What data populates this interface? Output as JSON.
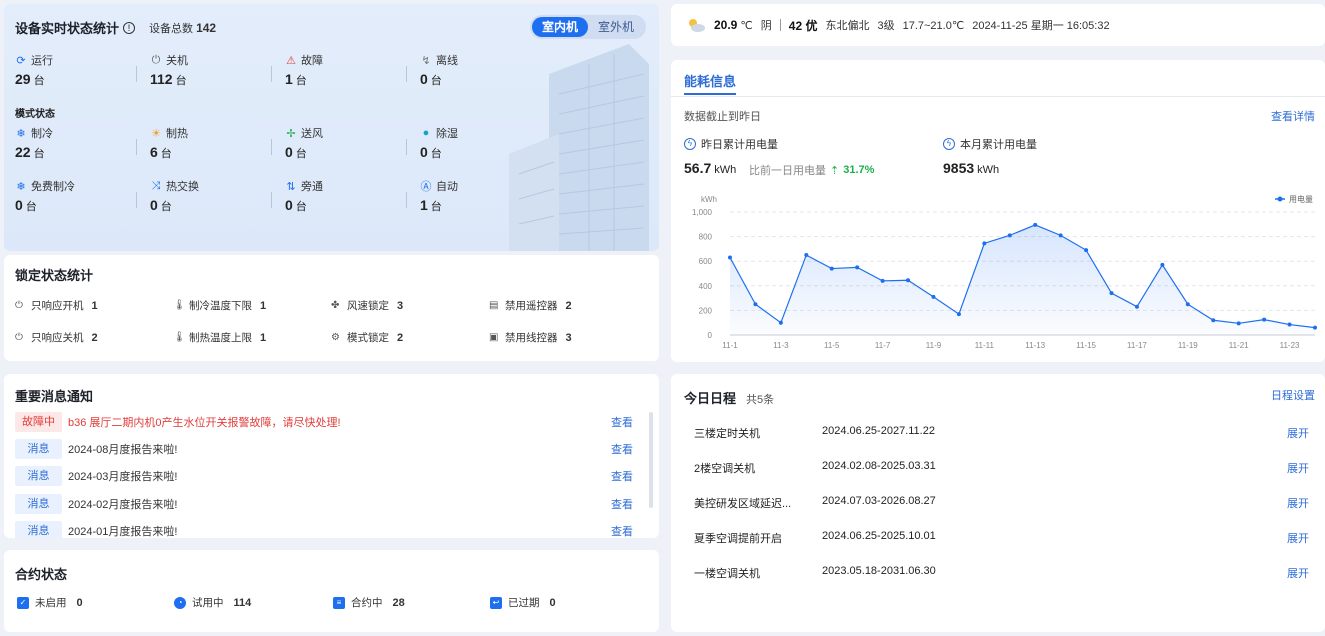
{
  "device": {
    "title": "设备实时状态统计",
    "total_label": "设备总数",
    "total": "142",
    "tabs": [
      "室内机",
      "室外机"
    ],
    "stats": [
      {
        "label": "运行",
        "value": "29",
        "unit": "台"
      },
      {
        "label": "关机",
        "value": "112",
        "unit": "台"
      },
      {
        "label": "故障",
        "value": "1",
        "unit": "台"
      },
      {
        "label": "离线",
        "value": "0",
        "unit": "台"
      }
    ],
    "mode_title": "模式状态",
    "modes": [
      {
        "label": "制冷",
        "value": "22",
        "unit": "台"
      },
      {
        "label": "制热",
        "value": "6",
        "unit": "台"
      },
      {
        "label": "送风",
        "value": "0",
        "unit": "台"
      },
      {
        "label": "除湿",
        "value": "0",
        "unit": "台"
      },
      {
        "label": "免费制冷",
        "value": "0",
        "unit": "台"
      },
      {
        "label": "热交换",
        "value": "0",
        "unit": "台"
      },
      {
        "label": "旁通",
        "value": "0",
        "unit": "台"
      },
      {
        "label": "自动",
        "value": "1",
        "unit": "台"
      }
    ]
  },
  "lock": {
    "title": "锁定状态统计",
    "items": [
      {
        "label": "只响应开机",
        "value": "1"
      },
      {
        "label": "制冷温度下限",
        "value": "1"
      },
      {
        "label": "风速锁定",
        "value": "3"
      },
      {
        "label": "禁用遥控器",
        "value": "2"
      },
      {
        "label": "只响应关机",
        "value": "2"
      },
      {
        "label": "制热温度上限",
        "value": "1"
      },
      {
        "label": "模式锁定",
        "value": "2"
      },
      {
        "label": "禁用线控器",
        "value": "3"
      }
    ]
  },
  "messages": {
    "title": "重要消息通知",
    "view_label": "查看",
    "items": [
      {
        "tag": "故障中",
        "text": "b36 展厅二期内机0产生水位开关报警故障，请尽快处理!"
      },
      {
        "tag": "消息",
        "text": "2024-08月度报告来啦!"
      },
      {
        "tag": "消息",
        "text": "2024-03月度报告来啦!"
      },
      {
        "tag": "消息",
        "text": "2024-02月度报告来啦!"
      },
      {
        "tag": "消息",
        "text": "2024-01月度报告来啦!"
      }
    ]
  },
  "contract": {
    "title": "合约状态",
    "items": [
      {
        "label": "未启用",
        "value": "0"
      },
      {
        "label": "试用中",
        "value": "114"
      },
      {
        "label": "合约中",
        "value": "28"
      },
      {
        "label": "已过期",
        "value": "0"
      }
    ]
  },
  "weather": {
    "temp": "20.9",
    "temp_unit": "℃",
    "condition": "阴",
    "aqi": "42 优",
    "wind": "东北偏北",
    "level": "3级",
    "range": "17.7~21.0℃",
    "datetime": "2024-11-25 星期一 16:05:32"
  },
  "energy": {
    "tab": "能耗信息",
    "subtitle": "数据截止到昨日",
    "detail_link": "查看详情",
    "yesterday_label": "昨日累计用电量",
    "yesterday_value": "56.7",
    "month_label": "本月累计用电量",
    "month_value": "9853",
    "unit": "kWh",
    "compare_label": "比前一日用电量",
    "compare_value": "31.7%"
  },
  "chart_data": {
    "type": "line",
    "ylabel": "kWh",
    "legend": "用电量",
    "ylim": [
      0,
      1000
    ],
    "yticks": [
      "0",
      "200",
      "400",
      "600",
      "800",
      "1,000"
    ],
    "x": [
      "11-1",
      "11-2",
      "11-3",
      "11-4",
      "11-5",
      "11-6",
      "11-7",
      "11-8",
      "11-9",
      "11-10",
      "11-11",
      "11-12",
      "11-13",
      "11-14",
      "11-15",
      "11-16",
      "11-17",
      "11-18",
      "11-19",
      "11-20",
      "11-21",
      "11-22",
      "11-23",
      "11-24"
    ],
    "xticks": [
      "11-1",
      "11-3",
      "11-5",
      "11-7",
      "11-9",
      "11-11",
      "11-13",
      "11-15",
      "11-17",
      "11-19",
      "11-21",
      "11-23"
    ],
    "series": [
      {
        "name": "用电量",
        "values": [
          630,
          250,
          100,
          650,
          540,
          550,
          440,
          445,
          310,
          170,
          745,
          810,
          895,
          810,
          690,
          340,
          230,
          570,
          250,
          120,
          95,
          125,
          85,
          60
        ]
      }
    ],
    "grid": true,
    "legend_position": "top-right"
  },
  "schedule": {
    "title": "今日日程",
    "count": "共5条",
    "settings": "日程设置",
    "expand_label": "展开",
    "items": [
      {
        "name": "三楼定时关机",
        "date": "2024.06.25-2027.11.22"
      },
      {
        "name": "2楼空调关机",
        "date": "2024.02.08-2025.03.31"
      },
      {
        "name": "美控研发区域延迟...",
        "date": "2024.07.03-2026.08.27"
      },
      {
        "name": "夏季空调提前开启",
        "date": "2024.06.25-2025.10.01"
      },
      {
        "name": "一楼空调关机",
        "date": "2023.05.18-2031.06.30"
      }
    ]
  }
}
